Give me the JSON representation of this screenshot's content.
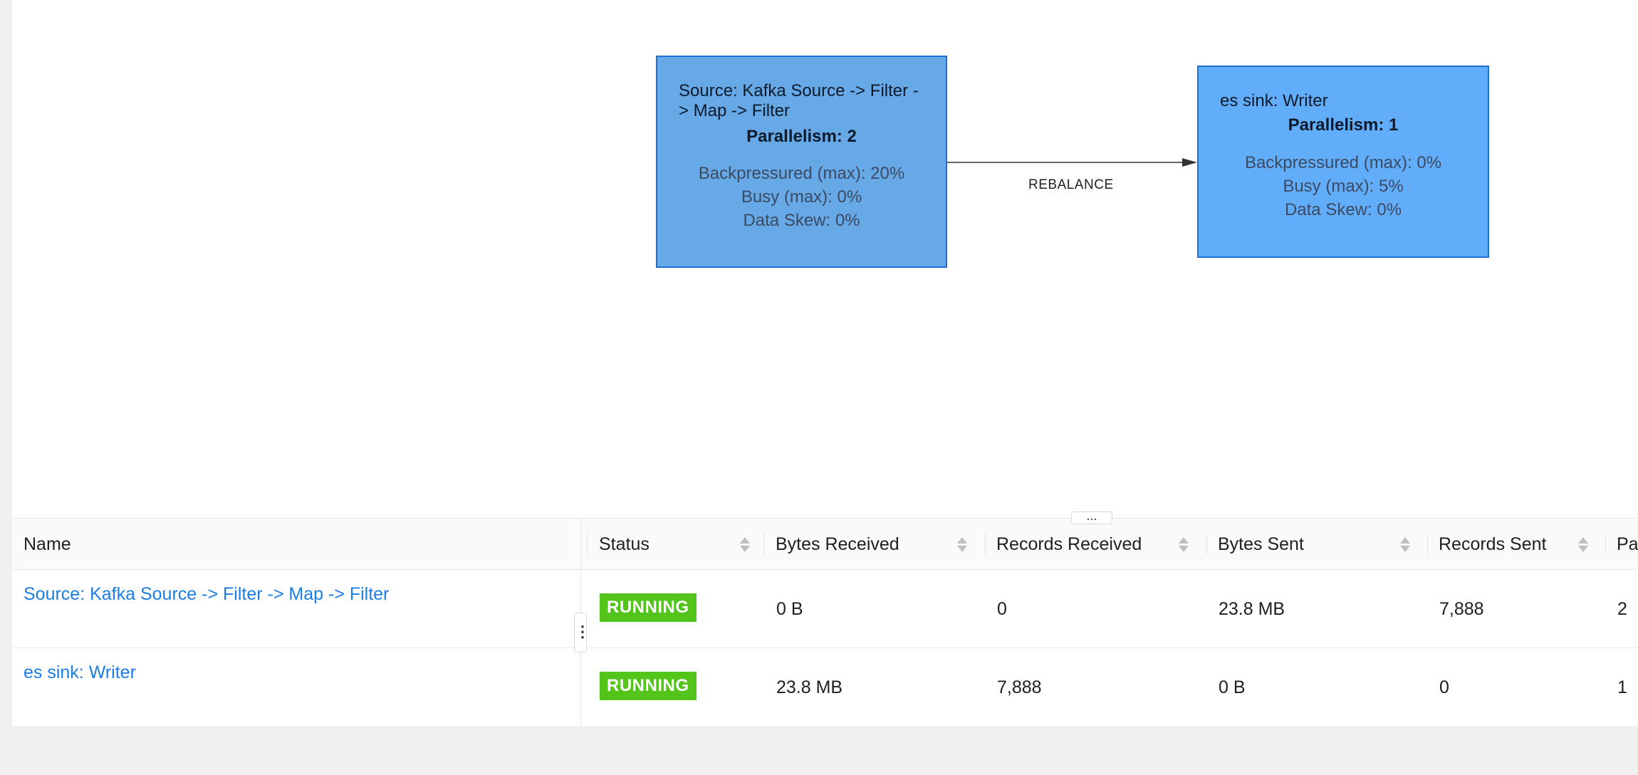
{
  "graph": {
    "nodes": [
      {
        "id": "source",
        "title": "Source: Kafka Source -> Filter -> Map -> Filter",
        "parallelism": "Parallelism: 2",
        "backpressured": "Backpressured (max): 20%",
        "busy": "Busy (max): 0%",
        "skew": "Data Skew: 0%",
        "color": "#66a9e6"
      },
      {
        "id": "sink",
        "title": "es sink: Writer",
        "parallelism": "Parallelism: 1",
        "backpressured": "Backpressured (max): 0%",
        "busy": "Busy (max): 5%",
        "skew": "Data Skew: 0%",
        "color": "#62adfa"
      }
    ],
    "edge_label": "REBALANCE"
  },
  "splitter": {
    "handle_glyph": "..."
  },
  "table": {
    "headers": {
      "name": "Name",
      "status": "Status",
      "bytes_received": "Bytes Received",
      "records_received": "Records Received",
      "bytes_sent": "Bytes Sent",
      "records_sent": "Records Sent",
      "parallelism": "Pa"
    },
    "rows": [
      {
        "name": "Source: Kafka Source -> Filter -> Map -> Filter",
        "status": "RUNNING",
        "bytes_received": "0 B",
        "records_received": "0",
        "bytes_sent": "23.8 MB",
        "records_sent": "7,888",
        "parallelism": "2"
      },
      {
        "name": "es sink: Writer",
        "status": "RUNNING",
        "bytes_received": "23.8 MB",
        "records_received": "7,888",
        "bytes_sent": "0 B",
        "records_sent": "0",
        "parallelism": "1"
      }
    ],
    "resizer_glyph": "⋮"
  },
  "colors": {
    "running": "#52c41a",
    "link": "#1a7ee6",
    "node_border": "#1f6fd6"
  }
}
